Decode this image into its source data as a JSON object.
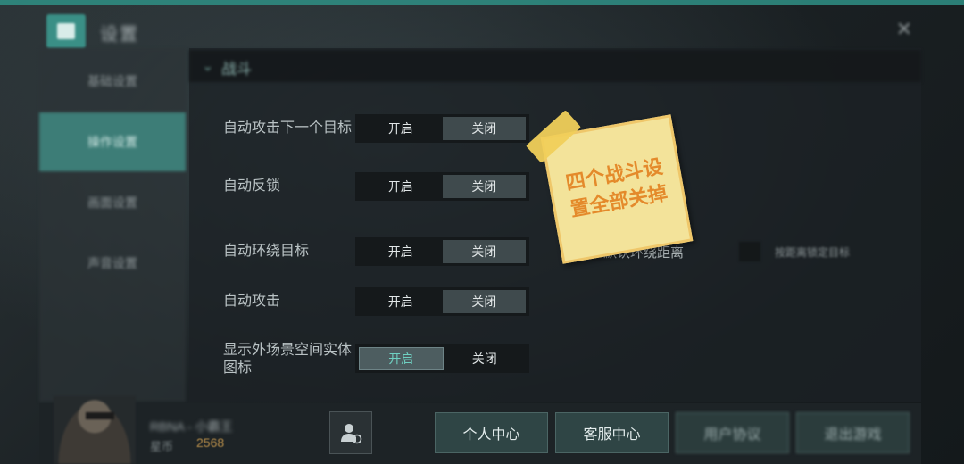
{
  "header": {
    "title": "设置",
    "home_icon": "home-icon",
    "close_icon": "close-icon"
  },
  "sidebar": {
    "items": [
      {
        "label": "基础设置"
      },
      {
        "label": "操作设置"
      },
      {
        "label": "画面设置"
      },
      {
        "label": "声音设置"
      }
    ],
    "active_index": 1
  },
  "section": {
    "title": "战斗"
  },
  "settings": [
    {
      "label": "自动攻击下一个目标",
      "on_label": "开启",
      "off_label": "关闭",
      "selected": "off"
    },
    {
      "label": "自动反锁",
      "on_label": "开启",
      "off_label": "关闭",
      "selected": "off"
    },
    {
      "label": "自动环绕目标",
      "on_label": "开启",
      "off_label": "关闭",
      "selected": "off"
    },
    {
      "label": "自动攻击",
      "on_label": "开启",
      "off_label": "关闭",
      "selected": "off"
    },
    {
      "label": "显示外场景空间实体图标",
      "on_label": "开启",
      "off_label": "关闭",
      "selected": "on"
    }
  ],
  "orbit_distance": {
    "label": "默认环绕距离",
    "extra_label": "按距离锁定目标"
  },
  "note": {
    "text": "四个战斗设置全部关掉"
  },
  "footer": {
    "player_name": "RBNA - 小霸王",
    "player_sub": "星币",
    "player_number": "2568",
    "buttons": [
      {
        "label": "个人中心"
      },
      {
        "label": "客服中心"
      },
      {
        "label": "用户协议"
      },
      {
        "label": "退出游戏"
      }
    ]
  },
  "colors": {
    "accent": "#3d7d77",
    "note_bg": "#f3e39a",
    "note_text": "#e48a2b"
  }
}
